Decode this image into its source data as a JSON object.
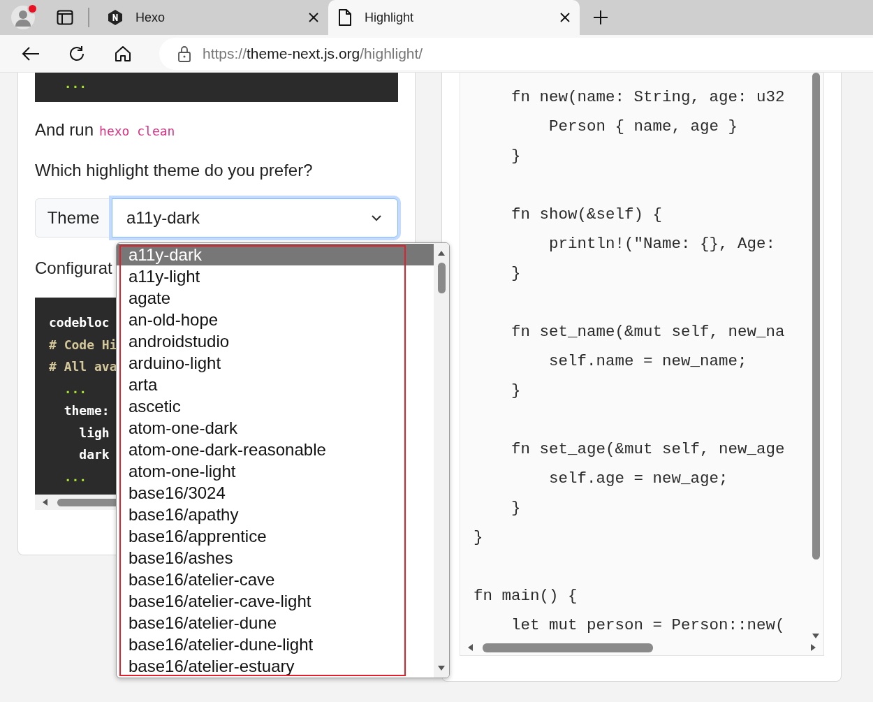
{
  "browser": {
    "profile": {
      "notification": true
    },
    "tabs": [
      {
        "title": "Hexo",
        "selected": false
      },
      {
        "title": "Highlight",
        "selected": true
      }
    ],
    "url": {
      "scheme": "https://",
      "domain": "theme-next.js.org",
      "path": "/highlight/"
    }
  },
  "article": {
    "top_code": [
      "  ..."
    ],
    "run_line": {
      "text": "And run",
      "command": "hexo clean"
    },
    "question": "Which highlight theme do you prefer?",
    "theme_select": {
      "label": "Theme",
      "value": "a11y-dark",
      "focused": true
    },
    "config_heading": "Configurat",
    "config_code": [
      {
        "kind": "key",
        "text": "codebloc"
      },
      {
        "kind": "comment",
        "text": "# Code Hi"
      },
      {
        "kind": "comment",
        "text": "# All ava"
      },
      {
        "kind": "ellipsis",
        "text": "  ..."
      },
      {
        "kind": "key",
        "text": "  theme:"
      },
      {
        "kind": "key",
        "text": "    ligh"
      },
      {
        "kind": "key",
        "text": "    dark"
      },
      {
        "kind": "ellipsis",
        "text": "  ..."
      }
    ]
  },
  "theme_dropdown": {
    "options": [
      {
        "label": "a11y-dark",
        "selected": true
      },
      {
        "label": "a11y-light",
        "selected": false
      },
      {
        "label": "agate",
        "selected": false
      },
      {
        "label": "an-old-hope",
        "selected": false
      },
      {
        "label": "androidstudio",
        "selected": false
      },
      {
        "label": "arduino-light",
        "selected": false
      },
      {
        "label": "arta",
        "selected": false
      },
      {
        "label": "ascetic",
        "selected": false
      },
      {
        "label": "atom-one-dark",
        "selected": false
      },
      {
        "label": "atom-one-dark-reasonable",
        "selected": false
      },
      {
        "label": "atom-one-light",
        "selected": false
      },
      {
        "label": "base16/3024",
        "selected": false
      },
      {
        "label": "base16/apathy",
        "selected": false
      },
      {
        "label": "base16/apprentice",
        "selected": false
      },
      {
        "label": "base16/ashes",
        "selected": false
      },
      {
        "label": "base16/atelier-cave",
        "selected": false
      },
      {
        "label": "base16/atelier-cave-light",
        "selected": false
      },
      {
        "label": "base16/atelier-dune",
        "selected": false
      },
      {
        "label": "base16/atelier-dune-light",
        "selected": false
      },
      {
        "label": "base16/atelier-estuary",
        "selected": false
      }
    ]
  },
  "code_preview": {
    "blocks": [
      [
        "    fn new(name: String, age: u32",
        "        Person { name, age }",
        "    }"
      ],
      [
        "    fn show(&self) {",
        "        println!(\"Name: {}, Age:",
        "    }"
      ],
      [
        "    fn set_name(&mut self, new_na",
        "        self.name = new_name;",
        "    }"
      ],
      [
        "    fn set_age(&mut self, new_age",
        "        self.age = new_age;",
        "    }",
        "}"
      ],
      [
        "fn main() {",
        "    let mut person = Person::new("
      ]
    ]
  }
}
